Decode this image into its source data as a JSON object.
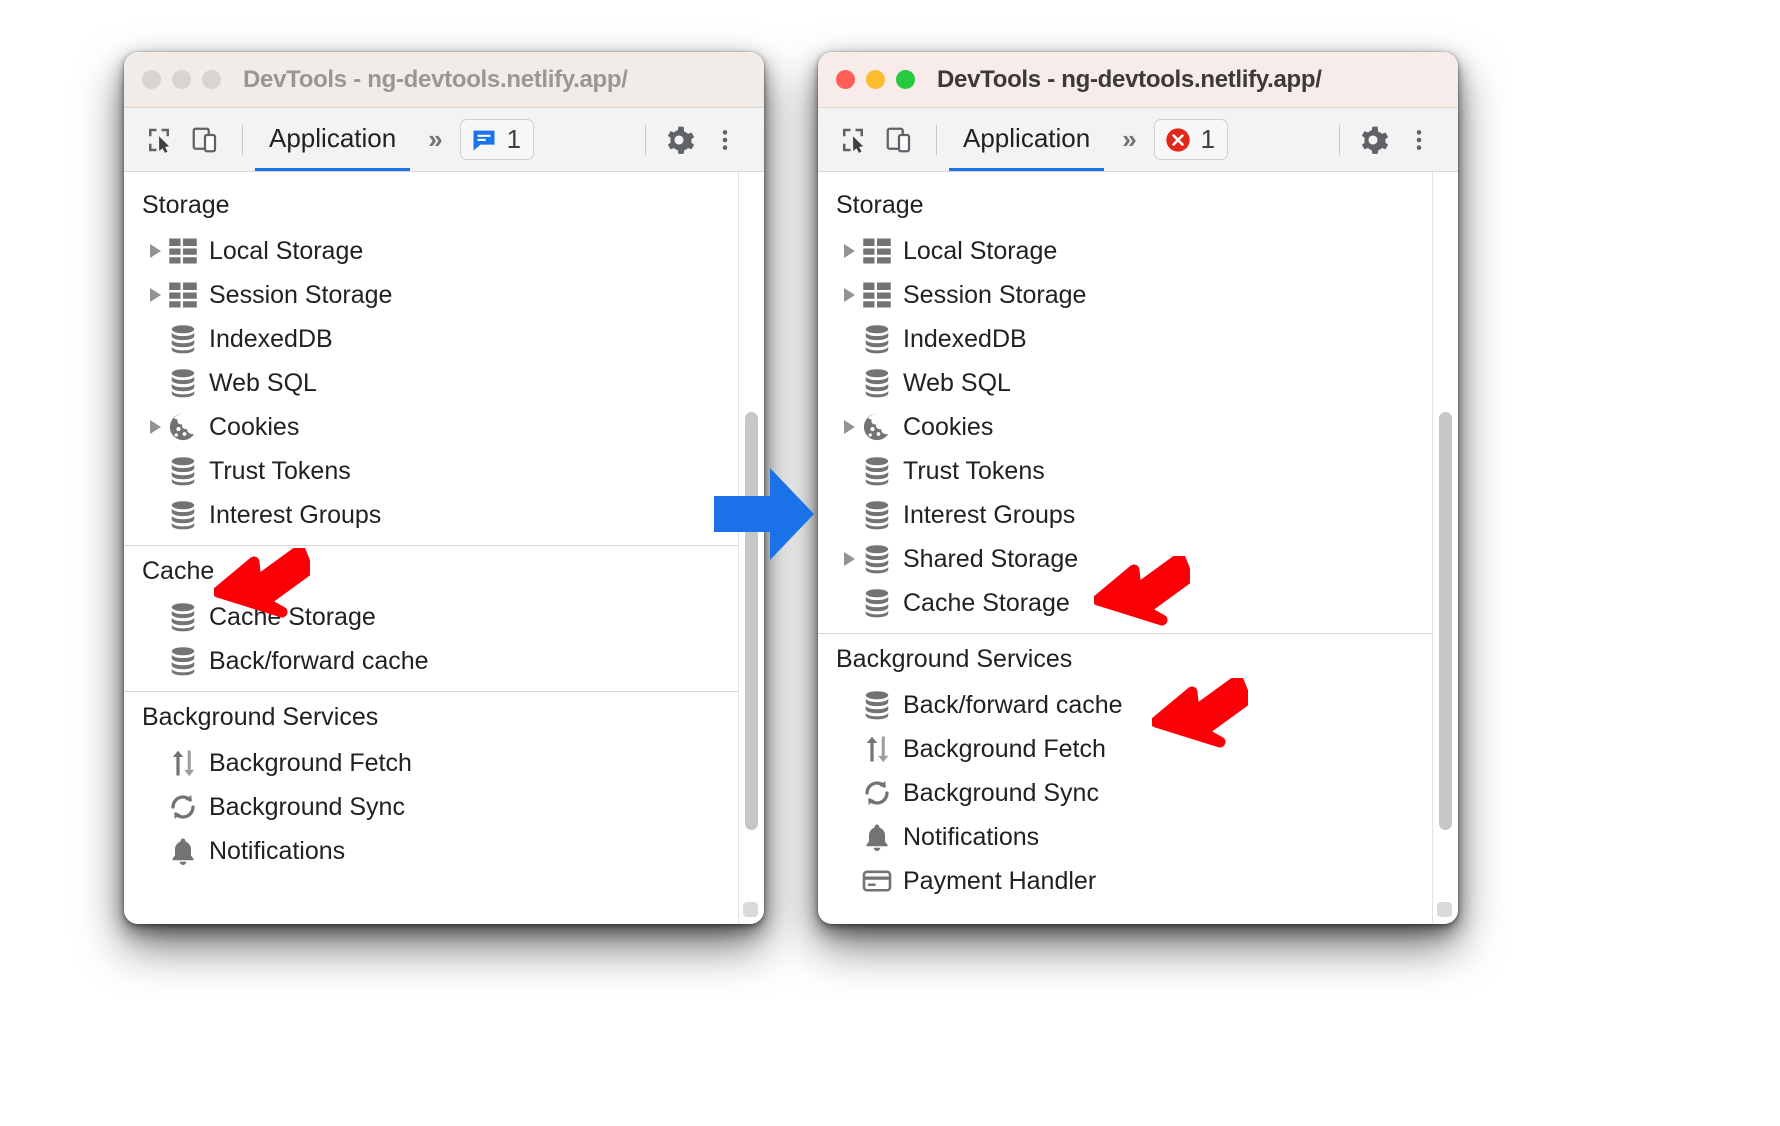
{
  "colors": {
    "accent_blue": "#1a73e8",
    "arrow_blue": "#1b72e8",
    "arrow_red": "#fb0007",
    "error_red": "#e1261c",
    "info_blue": "#1a73e8",
    "titlebar_inactive": "#f2ece9",
    "titlebar_active": "#f7ecea"
  },
  "windows": [
    {
      "id": "before",
      "state": "inactive",
      "titlebar": {
        "title": "DevTools - ng-devtools.netlify.app/",
        "lights": [
          {
            "name": "close-button",
            "color": "#d7d4d2"
          },
          {
            "name": "minimize-button",
            "color": "#d7d4d2"
          },
          {
            "name": "maximize-button",
            "color": "#d7d4d2"
          }
        ]
      },
      "toolbar": {
        "inspect_icon": "inspect-element-icon",
        "device_icon": "device-toolbar-icon",
        "tab_label": "Application",
        "more_tabs": "»",
        "badge": {
          "type": "info",
          "icon": "message-icon",
          "count": "1"
        },
        "settings_icon": "gear-icon",
        "menu_icon": "kebab-menu-icon"
      },
      "tree": [
        {
          "type": "section",
          "label": "Storage"
        },
        {
          "type": "item",
          "label": "Local Storage",
          "icon": "table-grid-icon",
          "expandable": true
        },
        {
          "type": "item",
          "label": "Session Storage",
          "icon": "table-grid-icon",
          "expandable": true
        },
        {
          "type": "item",
          "label": "IndexedDB",
          "icon": "database-icon",
          "expandable": false
        },
        {
          "type": "item",
          "label": "Web SQL",
          "icon": "database-icon",
          "expandable": false
        },
        {
          "type": "item",
          "label": "Cookies",
          "icon": "cookie-icon",
          "expandable": true
        },
        {
          "type": "item",
          "label": "Trust Tokens",
          "icon": "database-icon",
          "expandable": false
        },
        {
          "type": "item",
          "label": "Interest Groups",
          "icon": "database-icon",
          "expandable": false
        },
        {
          "type": "divider"
        },
        {
          "type": "section",
          "label": "Cache"
        },
        {
          "type": "item",
          "label": "Cache Storage",
          "icon": "database-icon",
          "expandable": false
        },
        {
          "type": "item",
          "label": "Back/forward cache",
          "icon": "database-icon",
          "expandable": false
        },
        {
          "type": "divider"
        },
        {
          "type": "section",
          "label": "Background Services"
        },
        {
          "type": "item",
          "label": "Background Fetch",
          "icon": "updown-arrows-icon",
          "expandable": false
        },
        {
          "type": "item",
          "label": "Background Sync",
          "icon": "sync-icon",
          "expandable": false
        },
        {
          "type": "item",
          "label": "Notifications",
          "icon": "bell-icon",
          "expandable": false
        }
      ]
    },
    {
      "id": "after",
      "state": "active",
      "titlebar": {
        "title": "DevTools - ng-devtools.netlify.app/",
        "lights": [
          {
            "name": "close-button",
            "color": "#ff5f57"
          },
          {
            "name": "minimize-button",
            "color": "#fdbc2e"
          },
          {
            "name": "maximize-button",
            "color": "#27c93f"
          }
        ]
      },
      "toolbar": {
        "inspect_icon": "inspect-element-icon",
        "device_icon": "device-toolbar-icon",
        "tab_label": "Application",
        "more_tabs": "»",
        "badge": {
          "type": "error",
          "icon": "error-circle-icon",
          "count": "1"
        },
        "settings_icon": "gear-icon",
        "menu_icon": "kebab-menu-icon"
      },
      "tree": [
        {
          "type": "section",
          "label": "Storage"
        },
        {
          "type": "item",
          "label": "Local Storage",
          "icon": "table-grid-icon",
          "expandable": true
        },
        {
          "type": "item",
          "label": "Session Storage",
          "icon": "table-grid-icon",
          "expandable": true
        },
        {
          "type": "item",
          "label": "IndexedDB",
          "icon": "database-icon",
          "expandable": false
        },
        {
          "type": "item",
          "label": "Web SQL",
          "icon": "database-icon",
          "expandable": false
        },
        {
          "type": "item",
          "label": "Cookies",
          "icon": "cookie-icon",
          "expandable": true
        },
        {
          "type": "item",
          "label": "Trust Tokens",
          "icon": "database-icon",
          "expandable": false
        },
        {
          "type": "item",
          "label": "Interest Groups",
          "icon": "database-icon",
          "expandable": false
        },
        {
          "type": "item",
          "label": "Shared Storage",
          "icon": "database-icon",
          "expandable": true
        },
        {
          "type": "item",
          "label": "Cache Storage",
          "icon": "database-icon",
          "expandable": false
        },
        {
          "type": "divider"
        },
        {
          "type": "section",
          "label": "Background Services"
        },
        {
          "type": "item",
          "label": "Back/forward cache",
          "icon": "database-icon",
          "expandable": false
        },
        {
          "type": "item",
          "label": "Background Fetch",
          "icon": "updown-arrows-icon",
          "expandable": false
        },
        {
          "type": "item",
          "label": "Background Sync",
          "icon": "sync-icon",
          "expandable": false
        },
        {
          "type": "item",
          "label": "Notifications",
          "icon": "bell-icon",
          "expandable": false
        },
        {
          "type": "item",
          "label": "Payment Handler",
          "icon": "credit-card-icon",
          "expandable": false
        }
      ]
    }
  ],
  "annotations": {
    "transition_arrow": "blue-right-arrow-icon",
    "callouts": [
      {
        "name": "red-arrow-cache-section",
        "points_to": "Cache"
      },
      {
        "name": "red-arrow-cache-storage",
        "points_to": "Cache Storage"
      },
      {
        "name": "red-arrow-back-forward-cache",
        "points_to": "Back/forward cache"
      }
    ]
  }
}
